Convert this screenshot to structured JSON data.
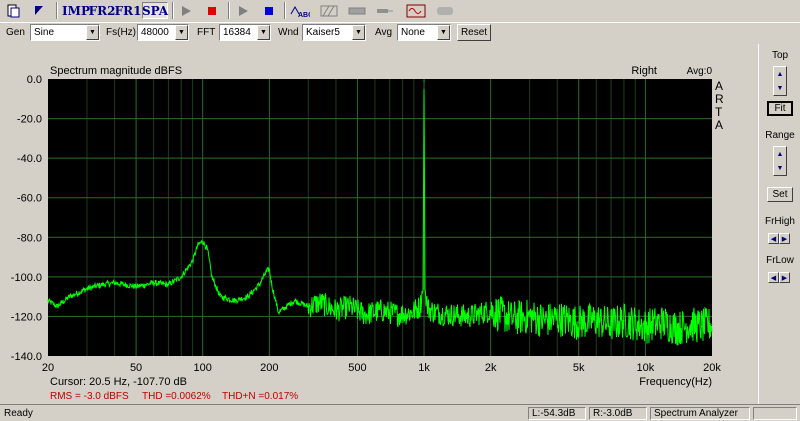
{
  "toolbar": {
    "imp_label": "IMP",
    "fr2_label": "FR2",
    "fr1_label": "FR1",
    "spa_label": "SPA"
  },
  "settings": {
    "gen_label": "Gen",
    "gen_value": "Sine",
    "fs_label": "Fs(Hz)",
    "fs_value": "48000",
    "fft_label": "FFT",
    "fft_value": "16384",
    "wnd_label": "Wnd",
    "wnd_value": "Kaiser5",
    "avg_label": "Avg",
    "avg_value": "None",
    "reset_label": "Reset"
  },
  "plot": {
    "title": "Spectrum magnitude dBFS",
    "channel": "Right",
    "avg_text": "Avg:0",
    "arta": [
      "A",
      "R",
      "T",
      "A"
    ],
    "xlabel": "Frequency(Hz)",
    "cursor_text": "Cursor:   20.5 Hz, -107.70 dB",
    "rms_text": "RMS =  -3.0 dBFS",
    "thd_text": "THD =0.0062%",
    "thdn_text": "THD+N =0.017%"
  },
  "chart_data": {
    "type": "line",
    "title": "Spectrum magnitude dBFS",
    "xlabel": "Frequency(Hz)",
    "ylabel": "",
    "xscale": "log",
    "xlim": [
      20,
      20000
    ],
    "ylim": [
      -140,
      0
    ],
    "grid": true,
    "xticks": [
      "20",
      "50",
      "100",
      "200",
      "500",
      "1k",
      "2k",
      "5k",
      "10k",
      "20k"
    ],
    "xtick_values": [
      20,
      50,
      100,
      200,
      500,
      1000,
      2000,
      5000,
      10000,
      20000
    ],
    "yticks": [
      "0.0",
      "-20.0",
      "-40.0",
      "-60.0",
      "-80.0",
      "-100.0",
      "-120.0",
      "-140.0"
    ],
    "ytick_values": [
      0,
      -20,
      -40,
      -60,
      -80,
      -100,
      -120,
      -140
    ],
    "series": [
      {
        "color": "#00ff00",
        "x": [
          20,
          22,
          25,
          30,
          35,
          40,
          45,
          50,
          55,
          60,
          70,
          80,
          90,
          95,
          100,
          105,
          110,
          120,
          140,
          160,
          180,
          195,
          200,
          205,
          220,
          260,
          300,
          340,
          400,
          460,
          540,
          640,
          760,
          880,
          960,
          990,
          1000,
          1010,
          1040,
          1120,
          1300,
          1600,
          2000,
          2500,
          3000,
          3500,
          4000,
          5000,
          6000,
          7000,
          8000,
          10000,
          12000,
          14000,
          16000,
          18000,
          20000
        ],
        "y": [
          -112,
          -115,
          -110,
          -106,
          -104,
          -103,
          -104,
          -105,
          -104,
          -103,
          -104,
          -100,
          -92,
          -84,
          -82,
          -86,
          -100,
          -110,
          -112,
          -110,
          -104,
          -97,
          -96,
          -104,
          -118,
          -112,
          -115,
          -113,
          -117,
          -115,
          -119,
          -117,
          -119,
          -118,
          -115,
          -106,
          -1,
          -106,
          -116,
          -118,
          -119,
          -120,
          -117,
          -121,
          -120,
          -122,
          -121,
          -123,
          -122,
          -124,
          -122,
          -125,
          -123,
          -126,
          -124,
          -125,
          -124
        ]
      }
    ]
  },
  "right_panel": {
    "top_label": "Top",
    "fit_label": "Fit",
    "range_label": "Range",
    "set_label": "Set",
    "frhigh_label": "FrHigh",
    "frlow_label": "FrLow"
  },
  "status": {
    "ready": "Ready",
    "left_level": "L:-54.3dB",
    "right_level": "R:-3.0dB",
    "mode": "Spectrum Analyzer"
  }
}
